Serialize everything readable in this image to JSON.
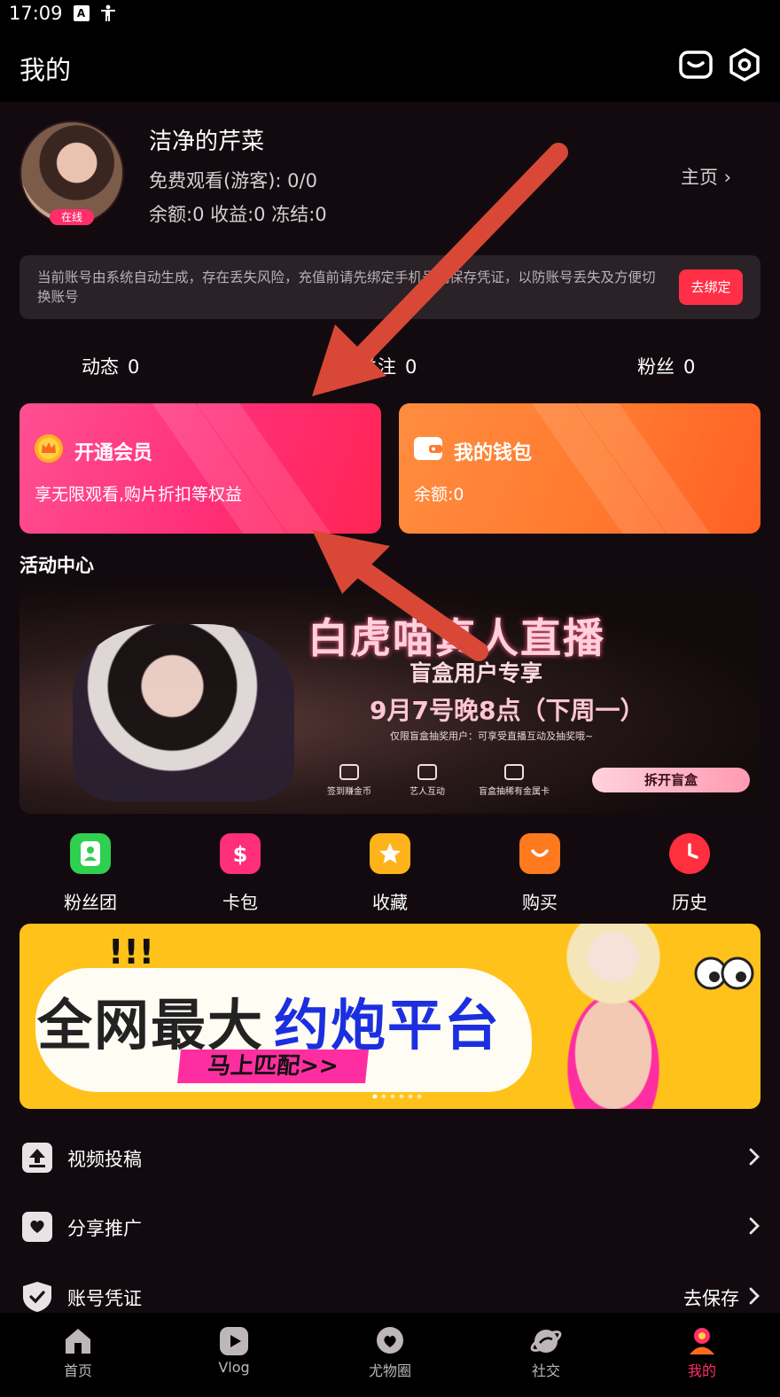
{
  "status_bar": {
    "time": "17:09",
    "icon_a": "A"
  },
  "header": {
    "title": "我的",
    "icons": [
      "message-icon",
      "settings-icon"
    ]
  },
  "profile": {
    "nickname": "洁净的芹菜",
    "online_badge": "在线",
    "free_watch": "免费观看(游客): 0/0",
    "balance_line": "余额:0 收益:0 冻结:0",
    "homepage_link": "主页 ›"
  },
  "notice": {
    "text": "当前账号由系统自动生成，存在丢失风险，充值前请先绑定手机号或保存凭证，以防账号丢失及方便切换账号",
    "bind_button": "去绑定"
  },
  "stats": [
    {
      "label": "动态",
      "value": "0"
    },
    {
      "label": "关注",
      "value": "0"
    },
    {
      "label": "粉丝",
      "value": "0"
    }
  ],
  "cards": {
    "vip": {
      "title": "开通会员",
      "subtitle": "享无限观看,购片折扣等权益",
      "color": "#ff3579"
    },
    "wallet": {
      "title": "我的钱包",
      "subtitle": "余额:0",
      "color": "#ff7a2f"
    }
  },
  "activity": {
    "section_title": "活动中心",
    "banner1": {
      "title": "白虎喵真人直播",
      "subtitle": "盲盒用户专享",
      "date": "9月7号晚8点（下周一）",
      "note": "仅限盲盒抽奖用户：可享受直播互动及抽奖哦~",
      "features": [
        "签到赚金币",
        "艺人互动",
        "盲盒抽稀有金属卡"
      ],
      "button": "拆开盲盒"
    }
  },
  "shortcuts": [
    {
      "label": "粉丝团",
      "icon": "fan-club-icon",
      "color": "#2fcf4f"
    },
    {
      "label": "卡包",
      "icon": "card-wallet-icon",
      "color": "#ff2f7a"
    },
    {
      "label": "收藏",
      "icon": "star-icon",
      "color": "#ffb31a"
    },
    {
      "label": "购买",
      "icon": "shopping-bag-icon",
      "color": "#ff7a1f"
    },
    {
      "label": "历史",
      "icon": "clock-icon",
      "color": "#ff2f3f"
    }
  ],
  "banner2": {
    "bangs": "!!!",
    "headline_a": "全网最大",
    "headline_b": "约炮平台",
    "match_button": "马上匹配>>"
  },
  "menu": [
    {
      "label": "视频投稿",
      "icon": "upload-icon",
      "action": ""
    },
    {
      "label": "分享推广",
      "icon": "share-icon",
      "action": ""
    },
    {
      "label": "账号凭证",
      "icon": "shield-icon",
      "action": "去保存"
    }
  ],
  "tabbar": [
    {
      "label": "首页",
      "icon": "home-icon"
    },
    {
      "label": "Vlog",
      "icon": "play-icon"
    },
    {
      "label": "尤物圈",
      "icon": "heart-chat-icon"
    },
    {
      "label": "社交",
      "icon": "planet-icon"
    },
    {
      "label": "我的",
      "icon": "profile-icon",
      "active": true
    }
  ],
  "accent_colors": {
    "brand_pink": "#ff2f6a",
    "arrow_red": "#d94836"
  }
}
